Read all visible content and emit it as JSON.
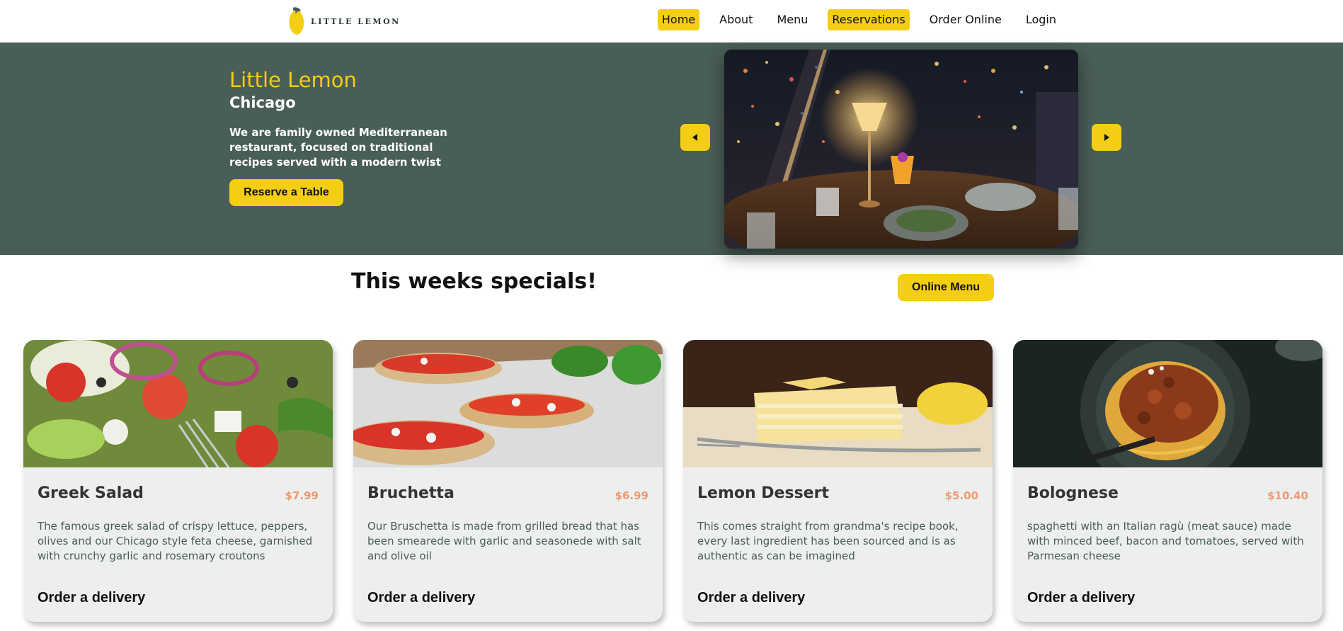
{
  "brand": {
    "name": "LITTLE LEMON",
    "accent": "#f4ce14",
    "primary": "#495e57"
  },
  "nav": {
    "items": [
      {
        "label": "Home",
        "highlighted": true
      },
      {
        "label": "About",
        "highlighted": false
      },
      {
        "label": "Menu",
        "highlighted": false
      },
      {
        "label": "Reservations",
        "highlighted": true
      },
      {
        "label": "Order Online",
        "highlighted": false
      },
      {
        "label": "Login",
        "highlighted": false
      }
    ]
  },
  "hero": {
    "title": "Little Lemon",
    "subtitle": "Chicago",
    "description": "We are family owned Mediterranean restaurant, focused on traditional recipes served with a modern twist",
    "cta_label": "Reserve a Table",
    "carousel_prev_icon": "triangle-left-icon",
    "carousel_next_icon": "triangle-right-icon"
  },
  "specials": {
    "title": "This weeks specials!",
    "menu_button_label": "Online Menu",
    "items": [
      {
        "name": "Greek Salad",
        "price": "$7.99",
        "description": "The famous greek salad of crispy lettuce, peppers, olives and our Chicago style feta cheese, garnished with crunchy garlic and rosemary croutons",
        "order_label": "Order a delivery"
      },
      {
        "name": "Bruchetta",
        "price": "$6.99",
        "description": "Our Bruschetta is made from grilled bread that has been smearede with garlic and seasonede with salt and olive oil",
        "order_label": "Order a delivery"
      },
      {
        "name": "Lemon Dessert",
        "price": "$5.00",
        "description": "This comes straight from grandma's recipe book, every last ingredient has been sourced and is as authentic as can be imagined",
        "order_label": "Order a delivery"
      },
      {
        "name": "Bolognese",
        "price": "$10.40",
        "description": "spaghetti with an Italian ragù (meat sauce) made with minced beef, bacon and tomatoes, served with Parmesan cheese",
        "order_label": "Order a delivery"
      }
    ]
  }
}
